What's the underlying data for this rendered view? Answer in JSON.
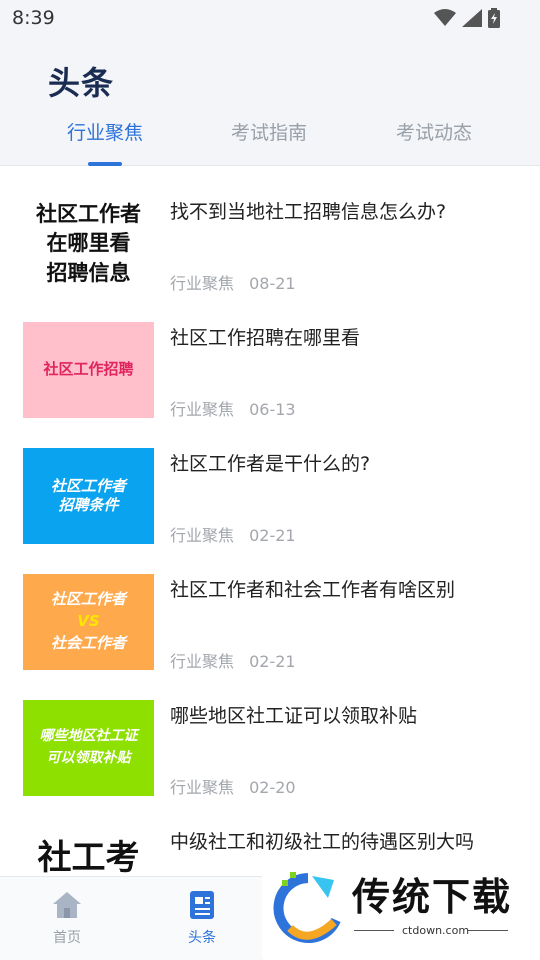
{
  "status": {
    "time": "8:39"
  },
  "header": {
    "title": "头条",
    "tabs": [
      {
        "label": "行业聚焦"
      },
      {
        "label": "考试指南"
      },
      {
        "label": "考试动态"
      }
    ],
    "active_tab": "行业聚焦"
  },
  "articles": [
    {
      "title": "找不到当地社工招聘信息怎么办?",
      "category": "行业聚焦",
      "date": "08-21",
      "thumb_lines": [
        "社区工作者",
        "在哪里看",
        "招聘信息"
      ],
      "thumb_bg": "#ffffff",
      "thumb_color": "#111111"
    },
    {
      "title": "社区工作招聘在哪里看",
      "category": "行业聚焦",
      "date": "06-13",
      "thumb_lines": [
        "社区工作招聘"
      ],
      "thumb_bg": "#ffc0cb",
      "thumb_color": "#e0245e"
    },
    {
      "title": "社区工作者是干什么的?",
      "category": "行业聚焦",
      "date": "02-21",
      "thumb_lines": [
        "社区工作者",
        "招聘条件"
      ],
      "thumb_bg": "#0aa3ef",
      "thumb_color": "#ffffff"
    },
    {
      "title": "社区工作者和社会工作者有啥区别",
      "category": "行业聚焦",
      "date": "02-21",
      "thumb_lines": [
        "社区工作者",
        "VS",
        "社会工作者"
      ],
      "thumb_bg": "#ffa94d",
      "thumb_color": "#ffffff"
    },
    {
      "title": "哪些地区社工证可以领取补贴",
      "category": "行业聚焦",
      "date": "02-20",
      "thumb_lines": [
        "哪些地区社工证",
        "可以领取补贴"
      ],
      "thumb_bg": "#8ee000",
      "thumb_color": "#ffffff"
    },
    {
      "title": "中级社工和初级社工的待遇区别大吗",
      "category": "",
      "date": "",
      "thumb_lines": [
        "社工考试"
      ],
      "thumb_bg": "#ffffff",
      "thumb_color": "#111111"
    }
  ],
  "bottom_nav": {
    "items": [
      {
        "label": "首页",
        "icon": "home-icon"
      },
      {
        "label": "头条",
        "icon": "news-icon"
      }
    ],
    "active": "头条"
  },
  "watermark": {
    "text": "传统下载",
    "sub": "ctdown.com"
  },
  "colors": {
    "accent": "#2d73d9",
    "title": "#1b2c52",
    "meta": "#a3a7ad"
  }
}
